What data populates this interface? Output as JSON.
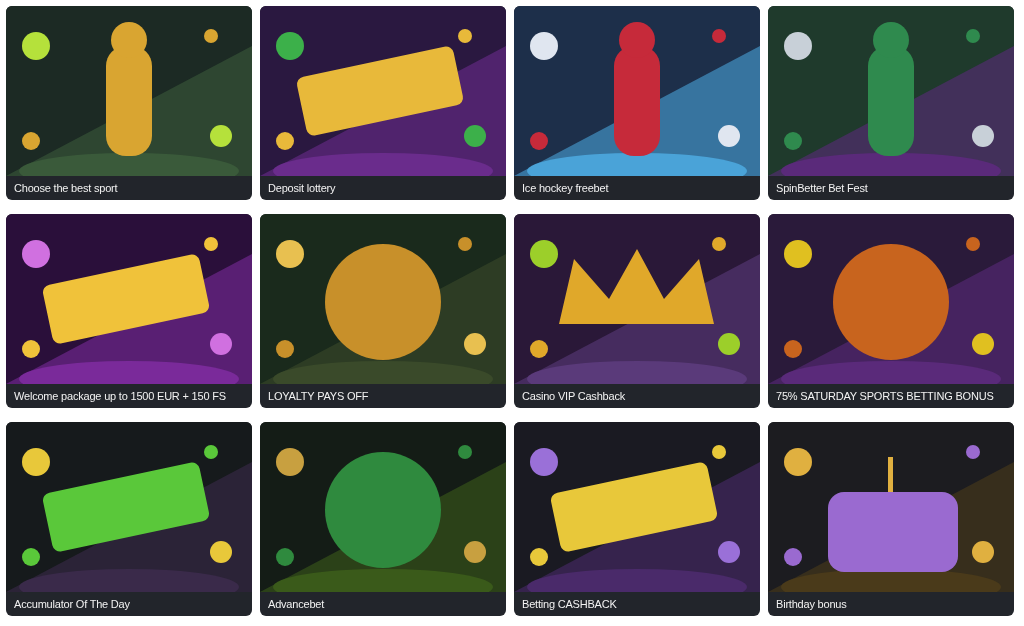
{
  "promotions": [
    {
      "title": "Choose the best sport"
    },
    {
      "title": "Deposit lottery"
    },
    {
      "title": "Ice hockey freebet"
    },
    {
      "title": "SpinBetter Bet Fest"
    },
    {
      "title": "Welcome package up to 1500 EUR + 150 FS"
    },
    {
      "title": "LOYALTY PAYS OFF"
    },
    {
      "title": "Casino VIP Cashback"
    },
    {
      "title": "75% SATURDAY SPORTS BETTING BONUS"
    },
    {
      "title": "Accumulator Of The Day"
    },
    {
      "title": "Advancebet"
    },
    {
      "title": "Betting CASHBACK"
    },
    {
      "title": "Birthday bonus"
    }
  ]
}
